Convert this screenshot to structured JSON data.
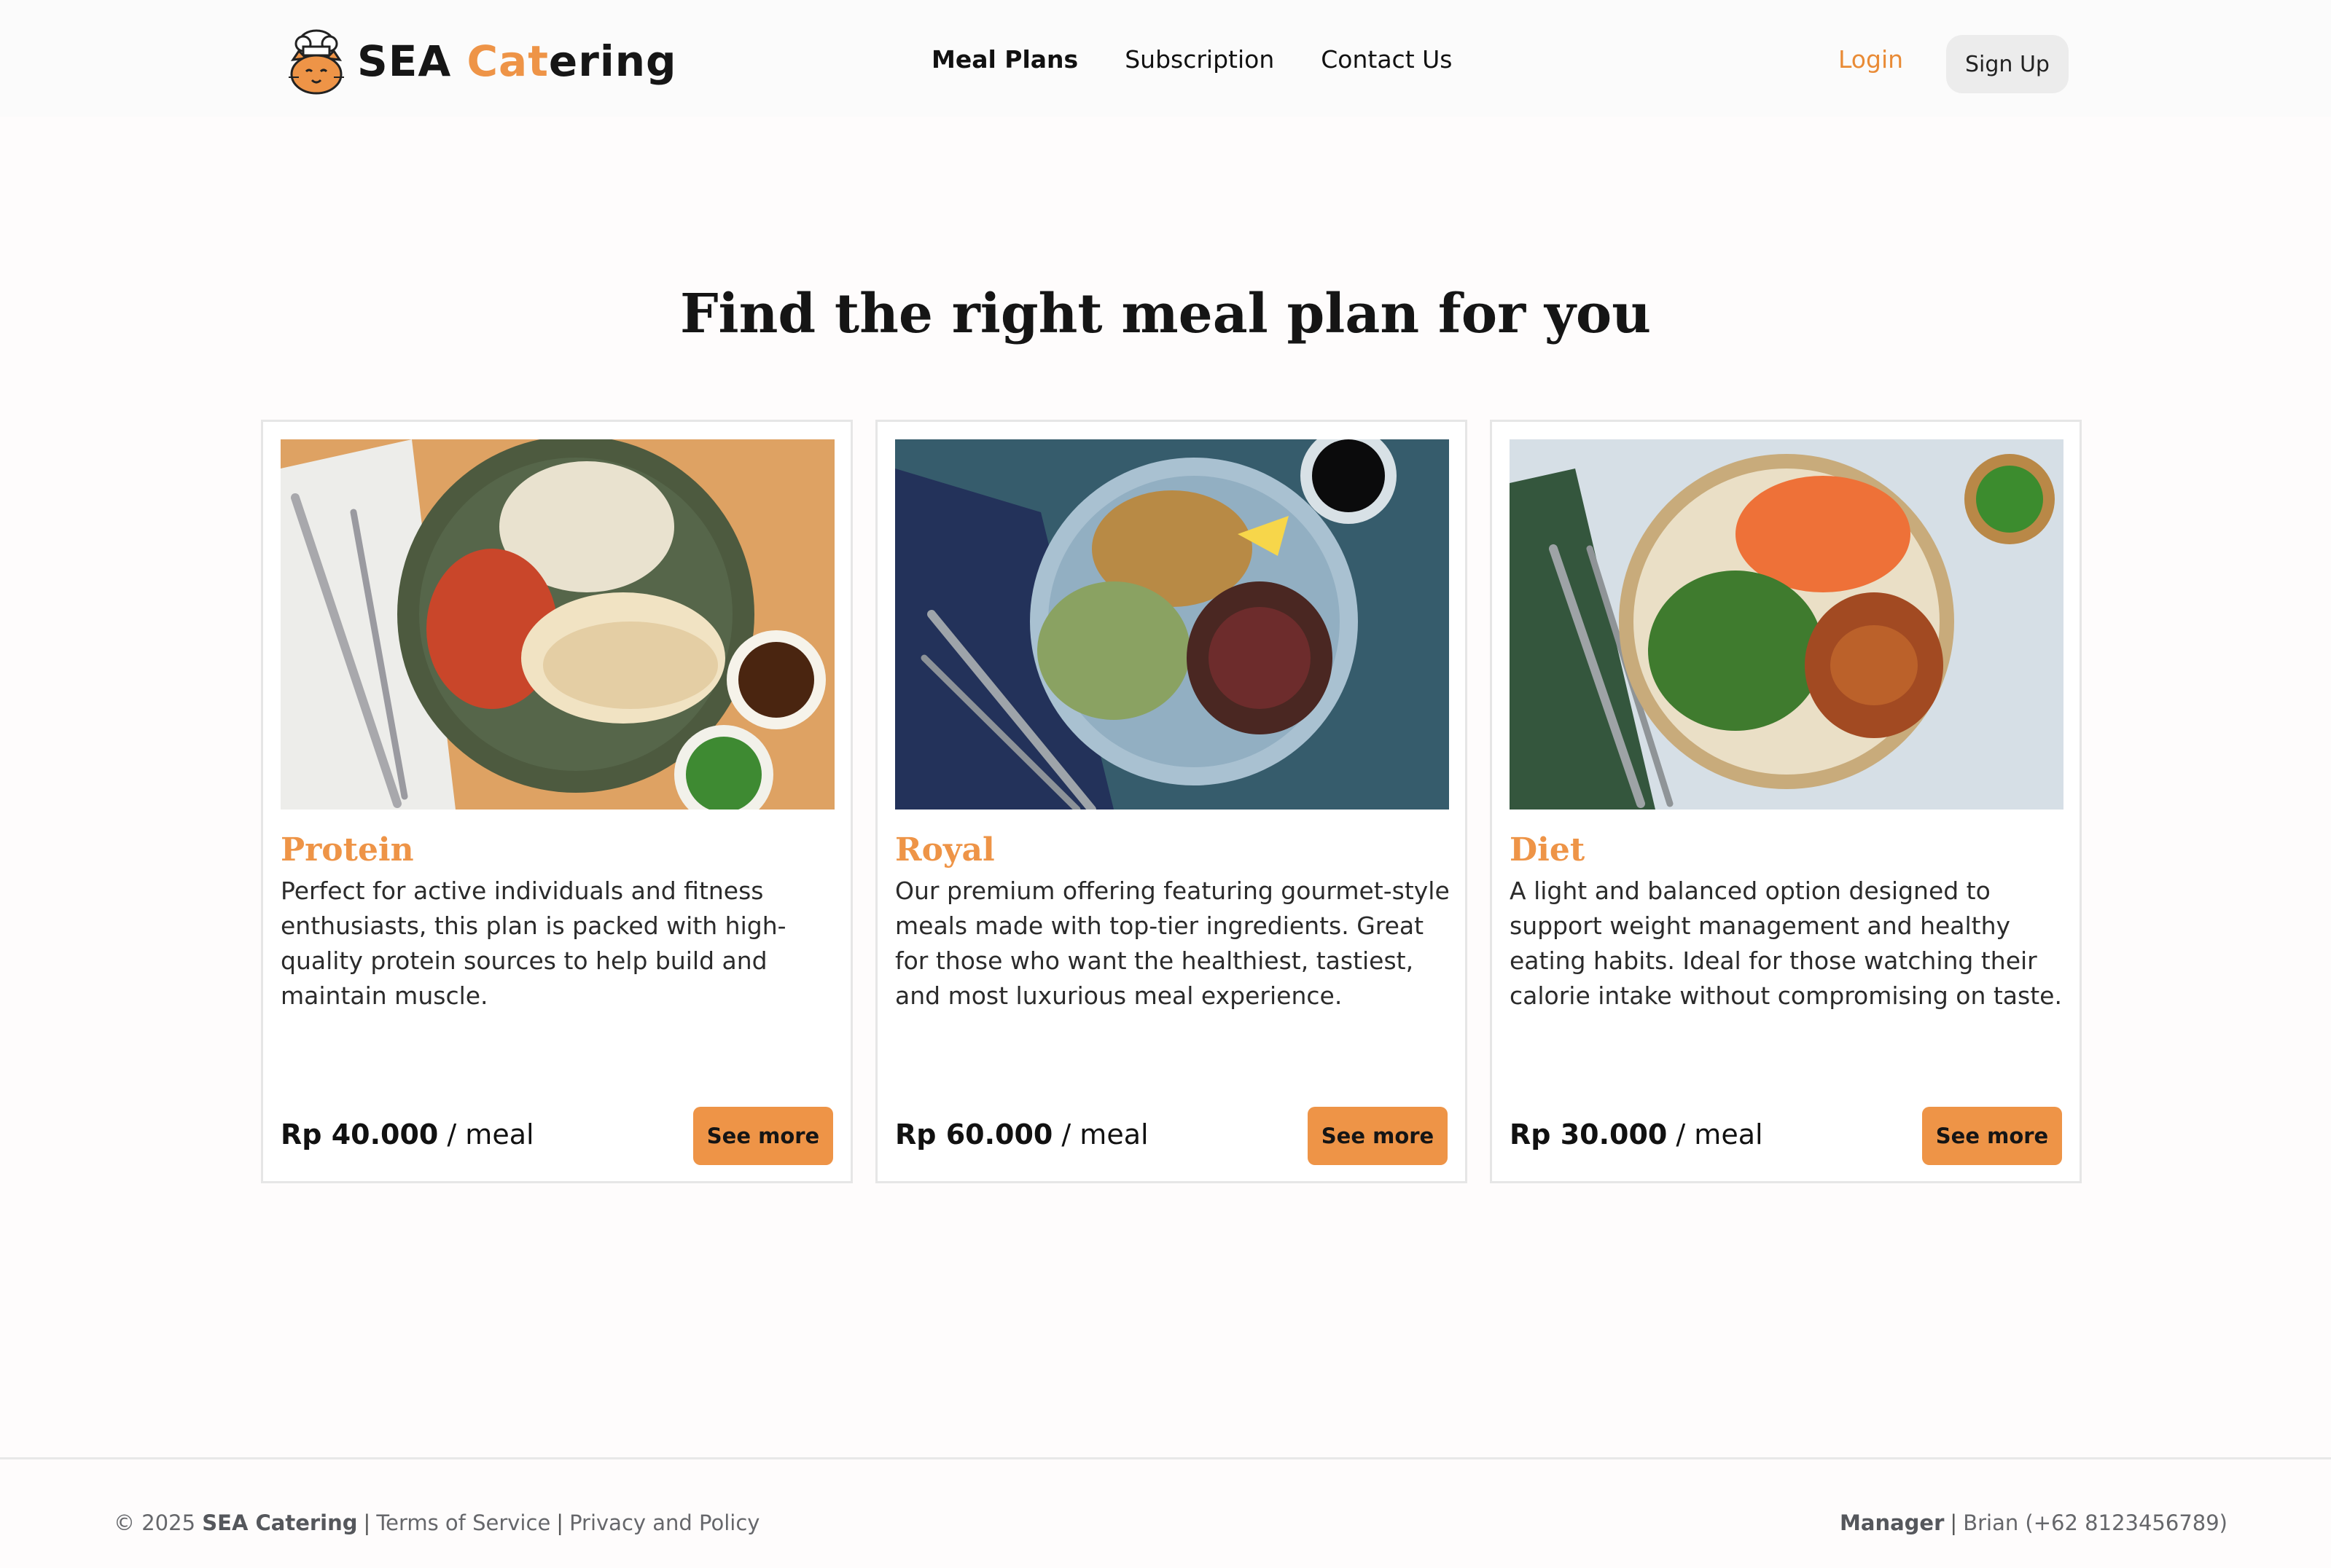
{
  "header": {
    "brand_part1": "SEA ",
    "brand_accent": "Cat",
    "brand_part2": "ering",
    "nav": [
      "Meal Plans",
      "Subscription",
      "Contact Us"
    ],
    "login_label": "Login",
    "signup_label": "Sign Up"
  },
  "main": {
    "headline": "Find the right meal plan for you"
  },
  "plans": [
    {
      "title": "Protein",
      "description": "Perfect for active individuals and fitness enthusiasts, this plan is packed with high-quality protein sources to help build and maintain muscle.",
      "price": "Rp 40.000",
      "unit": " / meal",
      "button": "See more"
    },
    {
      "title": "Royal",
      "description": "Our premium offering featuring gourmet-style meals made with top-tier ingredients. Great for those who want the healthiest, tastiest, and most luxurious meal experience.",
      "price": "Rp 60.000",
      "unit": " / meal",
      "button": "See more"
    },
    {
      "title": "Diet",
      "description": "A light and balanced option designed to support weight management and healthy eating habits. Ideal for those watching their calorie intake without compromising on taste.",
      "price": "Rp 30.000",
      "unit": " / meal",
      "button": "See more"
    }
  ],
  "footer": {
    "copyright_prefix": "© 2025 ",
    "company": "SEA Catering",
    "terms": "Terms of Service",
    "privacy": "Privacy and Policy",
    "separator": "|",
    "manager_label": "Manager",
    "manager_contact": "Brian (+62 8123456789)"
  },
  "colors": {
    "accent": "#ee9447",
    "login_text": "#e98b36"
  }
}
